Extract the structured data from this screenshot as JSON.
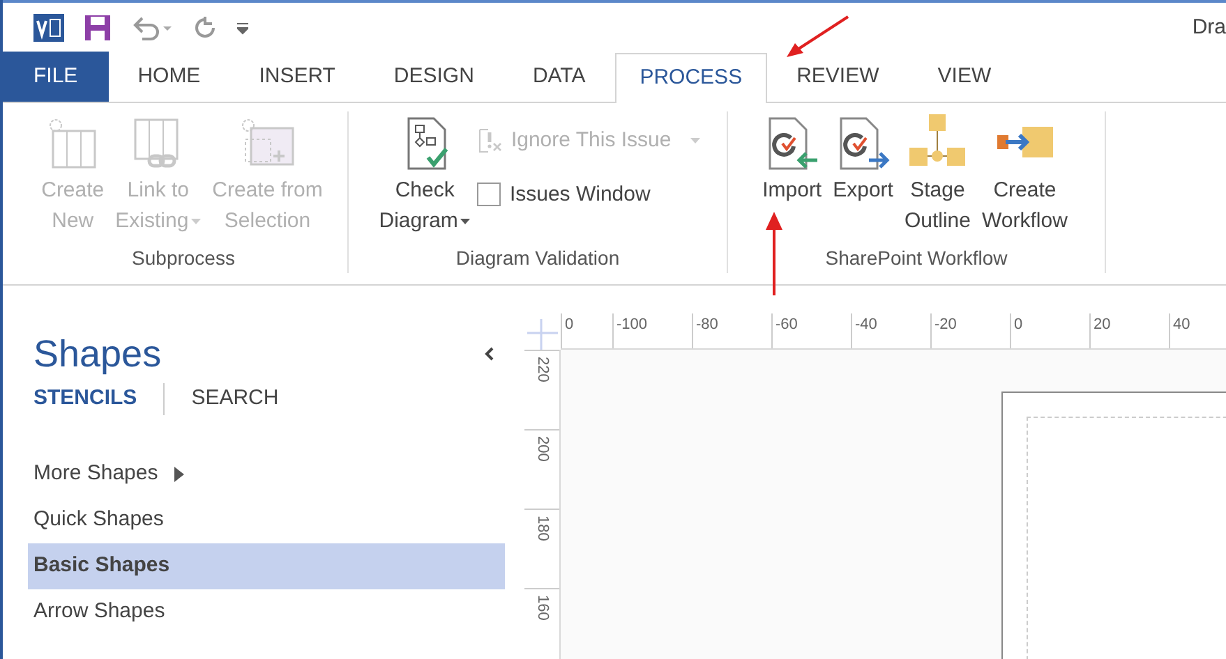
{
  "window": {
    "title": "Dra"
  },
  "tabs": [
    {
      "label": "FILE",
      "kind": "file",
      "selected": false
    },
    {
      "label": "HOME",
      "kind": "tab",
      "selected": false
    },
    {
      "label": "INSERT",
      "kind": "tab",
      "selected": false
    },
    {
      "label": "DESIGN",
      "kind": "tab",
      "selected": false
    },
    {
      "label": "DATA",
      "kind": "tab",
      "selected": false
    },
    {
      "label": "PROCESS",
      "kind": "tab",
      "selected": true
    },
    {
      "label": "REVIEW",
      "kind": "tab",
      "selected": false
    },
    {
      "label": "VIEW",
      "kind": "tab",
      "selected": false
    }
  ],
  "ribbon_groups": [
    {
      "label": "Subprocess",
      "items": [
        {
          "kind": "large",
          "lines": [
            "Create",
            "New"
          ],
          "disabled": true,
          "dropdown": false
        },
        {
          "kind": "large",
          "lines": [
            "Link to",
            "Existing"
          ],
          "disabled": true,
          "dropdown": true
        },
        {
          "kind": "large",
          "lines": [
            "Create from",
            "Selection"
          ],
          "disabled": true,
          "dropdown": false
        }
      ]
    },
    {
      "label": "Diagram Validation",
      "items": [
        {
          "kind": "large",
          "lines": [
            "Check",
            "Diagram"
          ],
          "disabled": false,
          "dropdown": true
        },
        {
          "kind": "small",
          "label": "Ignore This Issue",
          "disabled": true,
          "dropdown": true
        },
        {
          "kind": "checkbox",
          "label": "Issues Window",
          "checked": false,
          "disabled": false
        }
      ]
    },
    {
      "label": "SharePoint Workflow",
      "items": [
        {
          "kind": "large",
          "lines": [
            "Import"
          ],
          "disabled": false,
          "dropdown": false
        },
        {
          "kind": "large",
          "lines": [
            "Export"
          ],
          "disabled": false,
          "dropdown": false
        },
        {
          "kind": "large",
          "lines": [
            "Stage",
            "Outline"
          ],
          "disabled": false,
          "dropdown": false
        },
        {
          "kind": "large",
          "lines": [
            "Create",
            "Workflow"
          ],
          "disabled": false,
          "dropdown": false
        }
      ]
    }
  ],
  "shapes_panel": {
    "title": "Shapes",
    "tabs": [
      {
        "label": "STENCILS",
        "selected": true
      },
      {
        "label": "SEARCH",
        "selected": false
      }
    ],
    "items": [
      {
        "label": "More Shapes",
        "kind": "submenu",
        "selected": false
      },
      {
        "label": "Quick Shapes",
        "kind": "item",
        "selected": false
      },
      {
        "label": "Basic Shapes",
        "kind": "item",
        "selected": true
      },
      {
        "label": "Arrow Shapes",
        "kind": "item",
        "selected": false
      }
    ]
  },
  "ruler": {
    "horizontal": [
      "0",
      "-100",
      "-80",
      "-60",
      "-40",
      "-20",
      "0",
      "20",
      "40"
    ],
    "vertical": [
      "220",
      "200",
      "180",
      "160"
    ]
  }
}
